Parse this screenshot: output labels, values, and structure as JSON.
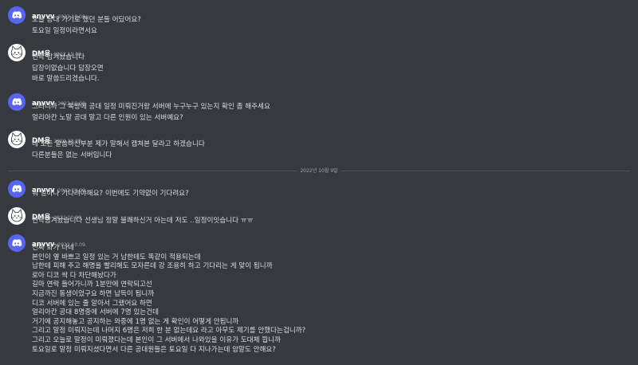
{
  "messages": [
    {
      "author": "anvvv",
      "avatar": "discord-logo",
      "timestamp": "2022.10.08.",
      "lines": [
        "오늘 공대 가기로 했던 분들 어딨어요?",
        "토요일 일정이라면서요"
      ]
    },
    {
      "author": "DM용",
      "avatar": "cat-face",
      "timestamp": "2022.10.08.",
      "lines": [
        "연락 남겨놨습니다",
        "답장이없습니다 답장오면",
        "바로 말씀드리겠습니다."
      ]
    },
    {
      "author": "anvvv",
      "avatar": "discord-logo",
      "timestamp": "2022.10.08.",
      "lines": [
        "그러니까 그 톡방에 공대 일정 미뤄진거랑 서버에 누구누구 있는지 확인 좀 해주세요",
        "얼리아칸 노말 공대 말고 다른 인원이 있는 서버예요?"
      ]
    },
    {
      "author": "DM용",
      "avatar": "cat-face",
      "timestamp": "2022.10.08.",
      "lines": [
        "네 모든 말씀하신부분 제가 말해서 캡쳐본 달라고 하겠습니다",
        "다른분들은 없는 서버입니다"
      ]
    },
    {
      "author": "anvvv",
      "avatar": "discord-logo",
      "timestamp": "2022.10.09.",
      "lines": [
        "뭐 얼마나 기다려야해요? 이번에도 기약없이 기다려요?"
      ]
    },
    {
      "author": "DM용",
      "avatar": "cat-face",
      "timestamp": "2022.10.09.",
      "lines": [
        "연락남겨놨습니다 선생님 정말 불쾌하신거 아는데 저도 ..일정이잇습니다 ㅠㅠ"
      ]
    },
    {
      "author": "anvvv",
      "avatar": "discord-logo",
      "timestamp": "2022.10.09.",
      "lines": [
        "진짜 화가 나네",
        "본인이 옆 바쁘고 일정 있는 거 남한테도 똑같이 적용되는데",
        "남한테 피해 주고 해명을 빨리해도 모자른데 강 조용히 하고 기다리는 게 맞이 됩니까",
        "로아 디코 싹 다 차단해놨다가",
        "길마 연락 들어가니까 1분만에 연락되고선",
        "지금까진 동생이었구요 하면 납득이 됩니까",
        "디코 서버에 있는 줄 알아서 그랬어요 하면",
        "얼리아칸 공대 8명중에 서버에 7명 있는건데",
        "거기에 공지해놓고 공지하는 와중에 1명 없는 게 확인이 어떻게 안됩니까",
        "그리고 말정 미뤄지는데 나머지 6명은 저희 한 분 없는데요 라고 아무도 제기를 안했다는겁니까?",
        "그리고 오늘로 말정이 미뤄졌다는데 본인이 그 서버에서 나와있을 이유가 도대체 뭡니까",
        "토요일로 말정 미뤄지셨다면서 다른 공대원들은 토요일 다 지나가는데 암말도 안해요?"
      ]
    }
  ],
  "date_divider": "2022년 10월 9일",
  "colors": {
    "background": "#36393f",
    "text": "#dcddde",
    "author": "#ffffff",
    "timestamp": "#a3a6aa",
    "discord_blurple": "#5865f2"
  }
}
